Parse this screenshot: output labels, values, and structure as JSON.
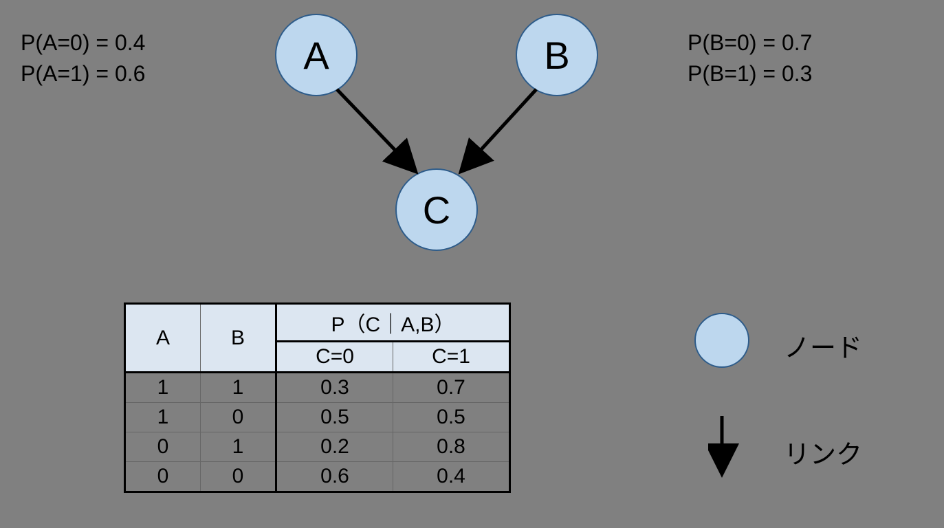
{
  "nodes": {
    "A": {
      "label": "A"
    },
    "B": {
      "label": "B"
    },
    "C": {
      "label": "C"
    }
  },
  "prob_A": {
    "line1": "P(A=0) = 0.4",
    "line2": "P(A=1) = 0.6"
  },
  "prob_B": {
    "line1": "P(B=0) = 0.7",
    "line2": "P(B=1) = 0.3"
  },
  "cpt": {
    "col_A": "A",
    "col_B": "B",
    "col_PCAB": "P（C｜A,B）",
    "col_C0": "C=0",
    "col_C1": "C=1",
    "rows": [
      {
        "a": "1",
        "b": "1",
        "c0": "0.3",
        "c1": "0.7"
      },
      {
        "a": "1",
        "b": "0",
        "c0": "0.5",
        "c1": "0.5"
      },
      {
        "a": "0",
        "b": "1",
        "c0": "0.2",
        "c1": "0.8"
      },
      {
        "a": "0",
        "b": "0",
        "c0": "0.6",
        "c1": "0.4"
      }
    ]
  },
  "legend": {
    "node_label": "ノード",
    "link_label": "リンク"
  },
  "chart_data": {
    "type": "bayesian-network-diagram",
    "nodes": [
      "A",
      "B",
      "C"
    ],
    "edges": [
      [
        "A",
        "C"
      ],
      [
        "B",
        "C"
      ]
    ],
    "priors": {
      "A": {
        "0": 0.4,
        "1": 0.6
      },
      "B": {
        "0": 0.7,
        "1": 0.3
      }
    },
    "cpt_C_given_AB": [
      {
        "A": 1,
        "B": 1,
        "C0": 0.3,
        "C1": 0.7
      },
      {
        "A": 1,
        "B": 0,
        "C0": 0.5,
        "C1": 0.5
      },
      {
        "A": 0,
        "B": 1,
        "C0": 0.2,
        "C1": 0.8
      },
      {
        "A": 0,
        "B": 0,
        "C0": 0.6,
        "C1": 0.4
      }
    ]
  }
}
